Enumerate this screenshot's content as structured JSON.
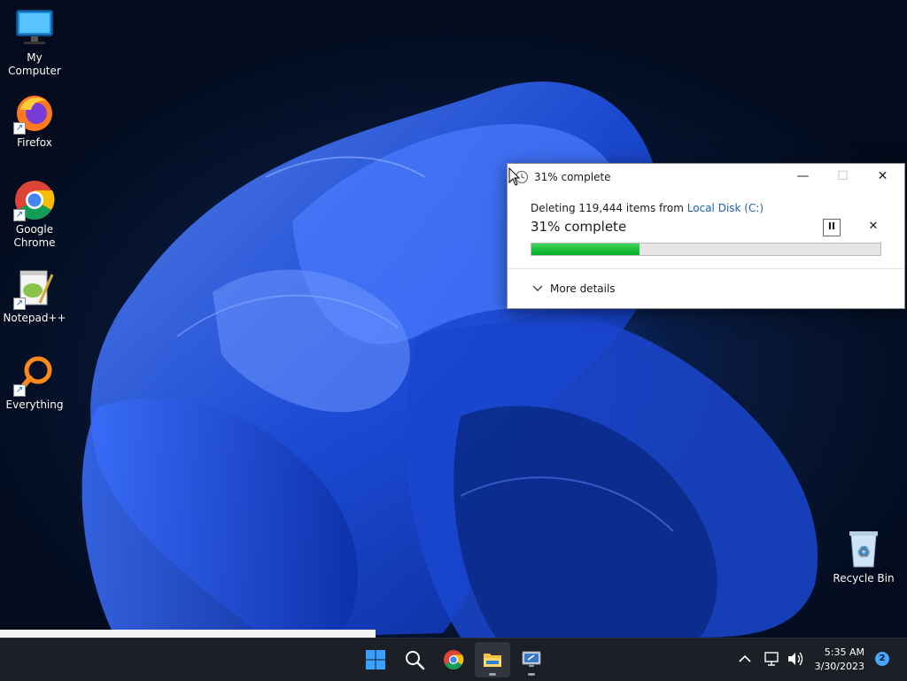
{
  "desktop": {
    "icons": [
      {
        "label": "My Computer",
        "icon": "monitor-icon"
      },
      {
        "label": "Firefox",
        "icon": "firefox-icon"
      },
      {
        "label": "Google Chrome",
        "icon": "chrome-icon"
      },
      {
        "label": "Notepad++",
        "icon": "notepadpp-icon"
      },
      {
        "label": "Everything",
        "icon": "everything-search-icon"
      },
      {
        "label": "Recycle Bin",
        "icon": "recycle-bin-icon"
      }
    ]
  },
  "dialog": {
    "title": "31% complete",
    "description_prefix": "Deleting 119,444 items from ",
    "source": "Local Disk (C:)",
    "percent_label": "31% complete",
    "progress": 0.31,
    "pause_symbol": "II",
    "cancel_symbol": "✕",
    "more_details": "More details",
    "controls": {
      "minimize": "—",
      "maximize": "☐",
      "close": "✕"
    }
  },
  "taskbar": {
    "apps": [
      "windows-start-icon",
      "search-icon",
      "chrome-icon",
      "file-explorer-icon",
      "remote-desktop-icon"
    ],
    "tray": {
      "time": "5:35 AM",
      "date": "3/30/2023",
      "notifications": "2"
    }
  },
  "colors": {
    "accent": "#1a5fb4",
    "progress_green": "#06b025",
    "taskbar": "#1c1f26"
  }
}
